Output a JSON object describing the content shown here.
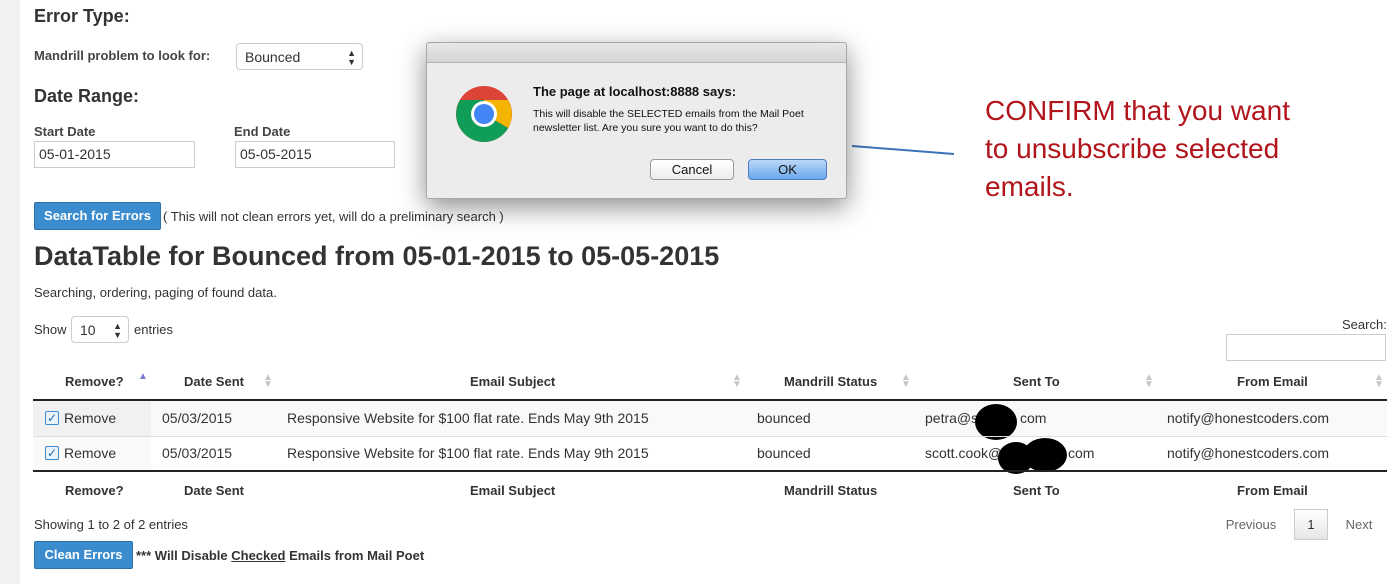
{
  "filters": {
    "error_type_heading": "Error Type:",
    "problem_label": "Mandrill problem to look for:",
    "problem_value": "Bounced",
    "date_range_heading": "Date Range:",
    "start_label": "Start Date",
    "start_value": "05-01-2015",
    "end_label": "End Date",
    "end_value": "05-05-2015",
    "search_button": "Search for Errors",
    "search_note": "( This will not clean errors yet, will do a preliminary search )"
  },
  "datatable": {
    "title": "DataTable for Bounced from 05-01-2015 to 05-05-2015",
    "subtitle": "Searching, ordering, paging of found data.",
    "show_label": "Show",
    "page_size": "10",
    "entries_label": "entries",
    "search_label": "Search:",
    "search_value": "",
    "columns": [
      "Remove?",
      "Date Sent",
      "Email Subject",
      "Mandrill Status",
      "Sent To",
      "From Email"
    ],
    "rows": [
      {
        "remove": "Remove",
        "checked": true,
        "date": "05/03/2015",
        "subject": "Responsive Website for $100 flat rate. Ends May 9th 2015",
        "status": "bounced",
        "sent_to_start": "petra@s",
        "sent_to_end": "com",
        "from": "notify@honestcoders.com"
      },
      {
        "remove": "Remove",
        "checked": true,
        "date": "05/03/2015",
        "subject": "Responsive Website for $100 flat rate. Ends May 9th 2015",
        "status": "bounced",
        "sent_to_start": "scott.cook@",
        "sent_to_end": "com",
        "from": "notify@honestcoders.com"
      }
    ],
    "info": "Showing 1 to 2 of 2 entries",
    "pagination": {
      "previous": "Previous",
      "current": "1",
      "next": "Next"
    }
  },
  "footer": {
    "clean_button": "Clean Errors",
    "note_prefix": "*** Will Disable ",
    "note_checked": "Checked",
    "note_suffix": " Emails from Mail Poet"
  },
  "dialog": {
    "title": "The page at localhost:8888 says:",
    "message": "This will disable the SELECTED emails from the Mail Poet newsletter list. Are you sure you want to do this?",
    "cancel": "Cancel",
    "ok": "OK"
  },
  "annotation": {
    "text": "CONFIRM that you want to unsubscribe selected emails.",
    "color": "#b1141a"
  },
  "colors": {
    "primary_button": "#3a8ccf",
    "sort_active": "#7b7bd1"
  }
}
